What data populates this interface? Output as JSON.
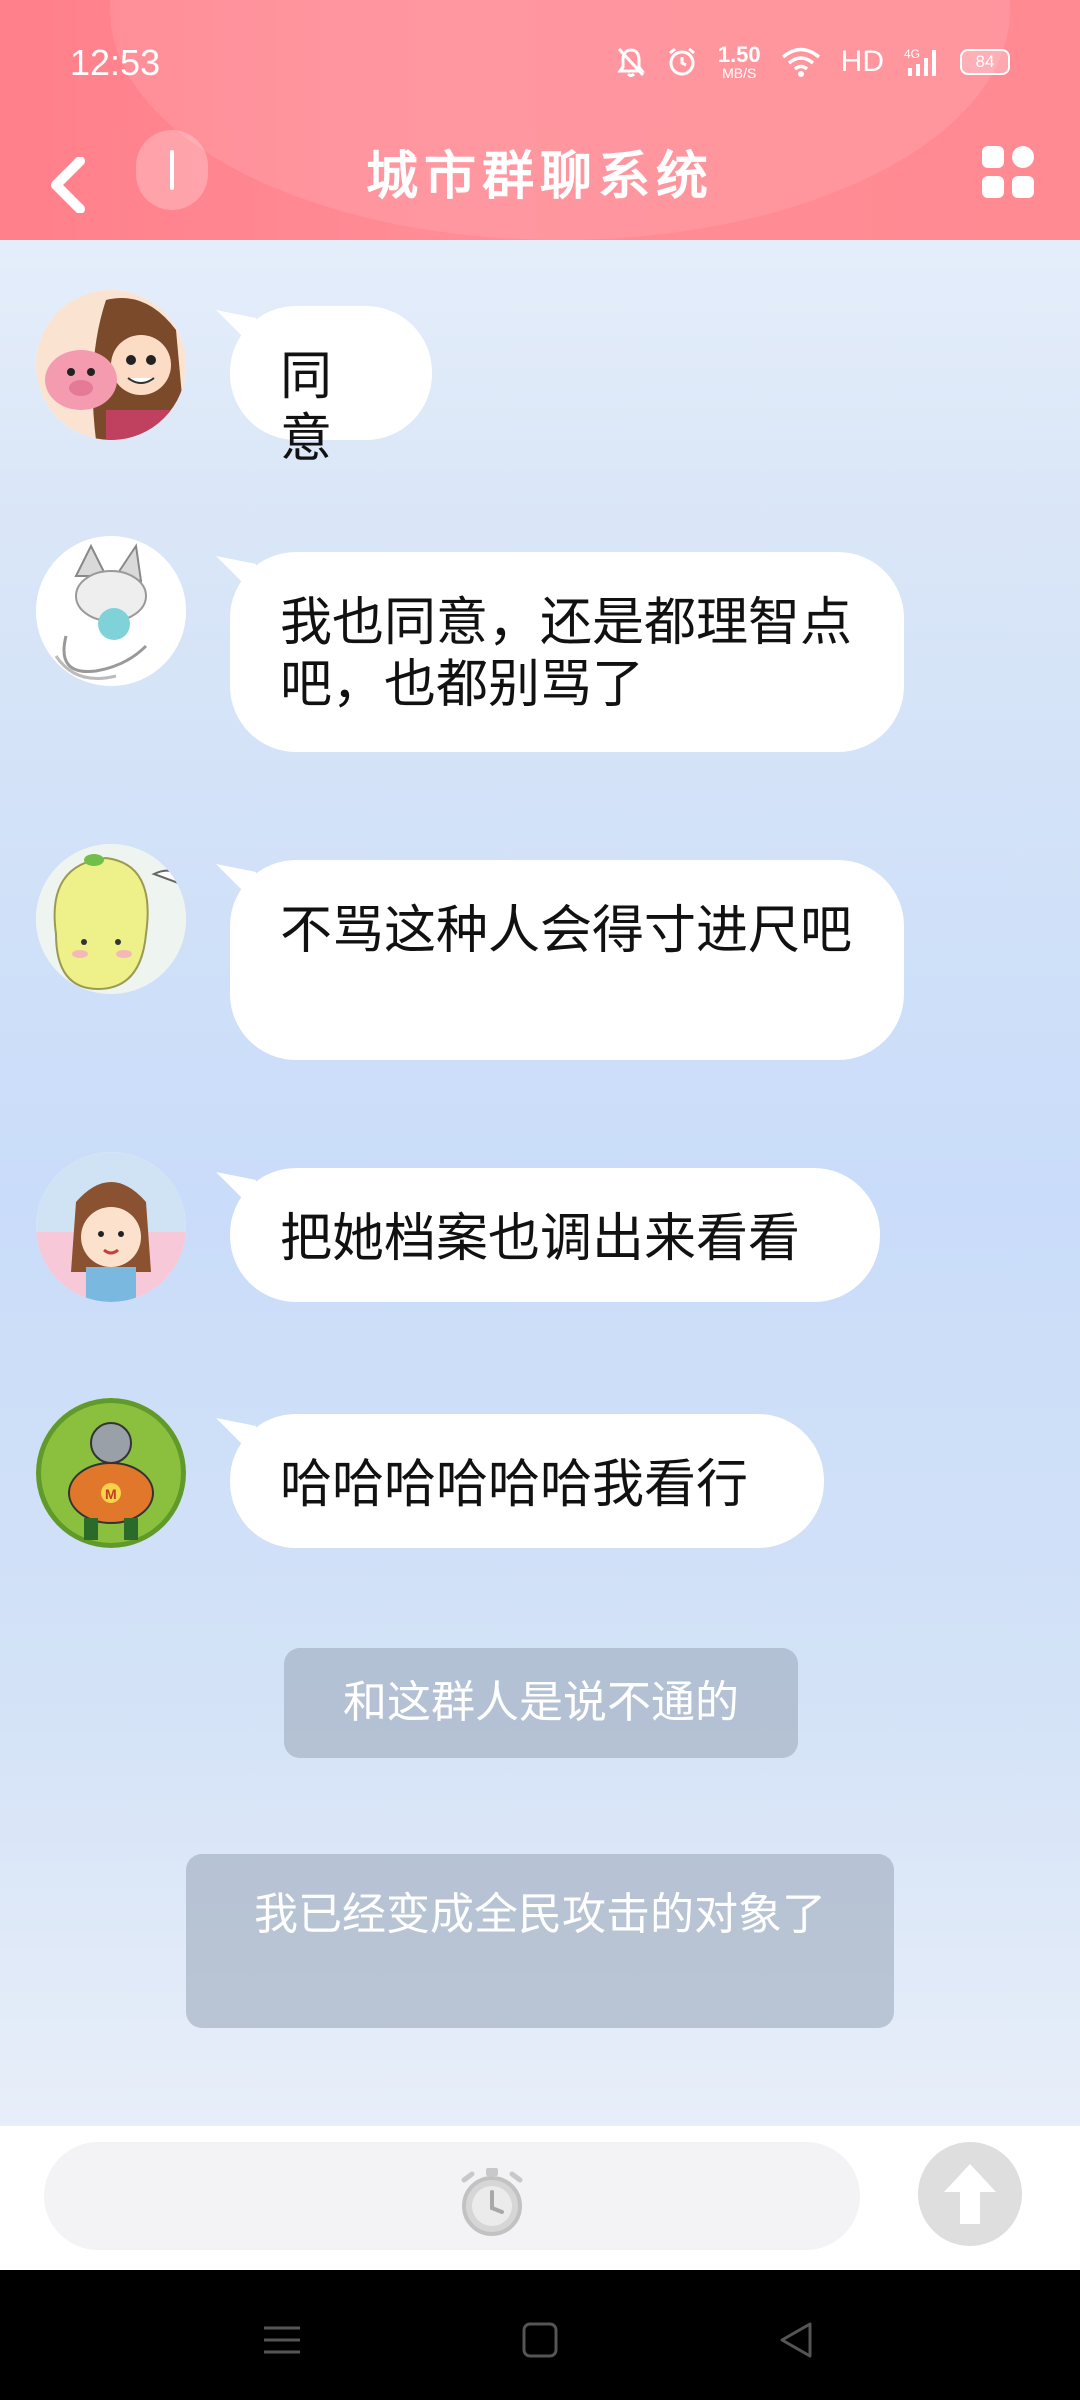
{
  "status_bar": {
    "time": "12:53",
    "speed_value": "1.50",
    "speed_unit": "MB/S",
    "network": "HD",
    "battery": "84"
  },
  "header": {
    "title": "城市群聊系统",
    "icons": [
      "back-icon",
      "cursor-icon",
      "grid-menu-icon"
    ]
  },
  "messages": [
    {
      "text": "同意",
      "avatar": "avatar-pig-girl"
    },
    {
      "text": "我也同意，还是都理智点吧，也都别骂了",
      "avatar": "avatar-fox"
    },
    {
      "text": "不骂这种人会得寸进尺吧",
      "avatar": "avatar-pear"
    },
    {
      "text": "把她档案也调出来看看",
      "avatar": "avatar-girl"
    },
    {
      "text": "哈哈哈哈哈哈我看行",
      "avatar": "avatar-cartoon-man"
    }
  ],
  "system_messages": [
    {
      "text": "和这群人是说不通的"
    },
    {
      "text": "我已经变成全民攻击的对象了"
    }
  ],
  "input": {
    "icons": [
      "timer-icon",
      "send-up-arrow-icon"
    ]
  },
  "nav_bar": {
    "icons": [
      "menu-icon",
      "home-icon",
      "back-triangle-icon"
    ]
  },
  "colors": {
    "header": "#ff8a93",
    "bubble": "#ffffff",
    "system_bubble": "#a0acbe"
  }
}
